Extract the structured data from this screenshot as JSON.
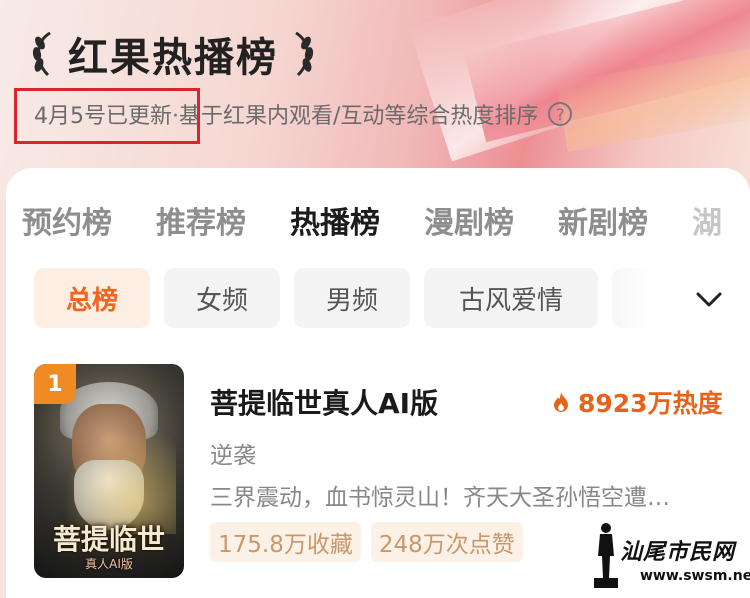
{
  "header": {
    "title": "红果热播榜",
    "update_date": "4月5号已更新",
    "sort_note": "·基于红果内观看/互动等综合热度排序",
    "help_glyph": "?"
  },
  "tabs": [
    {
      "label": "预约榜",
      "active": false
    },
    {
      "label": "推荐榜",
      "active": false
    },
    {
      "label": "热播榜",
      "active": true
    },
    {
      "label": "漫剧榜",
      "active": false
    },
    {
      "label": "新剧榜",
      "active": false
    },
    {
      "label": "湖",
      "active": false
    }
  ],
  "chips": [
    {
      "label": "总榜",
      "active": true
    },
    {
      "label": "女频",
      "active": false
    },
    {
      "label": "男频",
      "active": false
    },
    {
      "label": "古风爱情",
      "active": false
    }
  ],
  "ranking": [
    {
      "rank": "1",
      "title": "菩提临世真人AI版",
      "heat": "8923万热度",
      "genre": "逆袭",
      "description": "三界震动，血书惊灵山！齐天大圣孙悟空遭…",
      "favorites": "175.8万收藏",
      "likes": "248万次点赞",
      "cover_title": "菩提临世",
      "cover_subtitle": "真人AI版"
    }
  ],
  "watermark": {
    "text": "汕尾市民网",
    "url": "www.swsm.net"
  },
  "colors": {
    "accent": "#f0651e",
    "rank_badge": "#f08a22",
    "highlight_box": "#d9262c"
  },
  "icons": [
    "laurel-left-icon",
    "laurel-right-icon",
    "help-icon",
    "chevron-down-icon",
    "flame-icon"
  ]
}
